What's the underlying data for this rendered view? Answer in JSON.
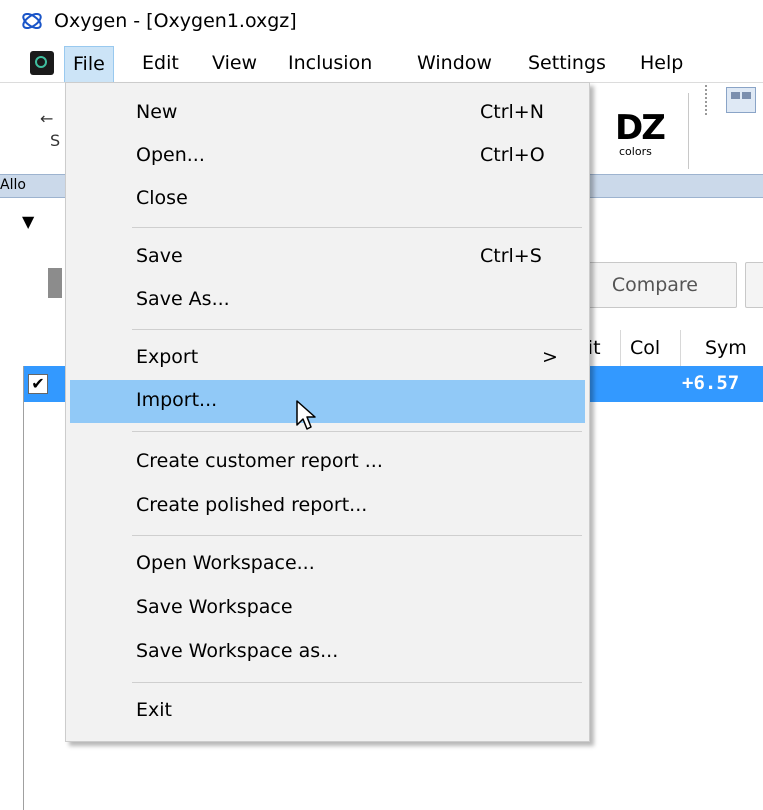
{
  "window": {
    "title": "Oxygen - [Oxygen1.oxgz]",
    "app_icon": "oxygen-logo-icon",
    "accent": "#1a55c8"
  },
  "menubar": {
    "items": [
      {
        "label": "File"
      },
      {
        "label": "Edit"
      },
      {
        "label": "View"
      },
      {
        "label": "Inclusion"
      },
      {
        "label": "Window"
      },
      {
        "label": "Settings"
      },
      {
        "label": "Help"
      }
    ]
  },
  "toolbar": {
    "frag1": "←",
    "frag2": "S",
    "dz_main": "DZ",
    "dz_sub": "colors"
  },
  "panel": {
    "label": "Allo"
  },
  "buttons": {
    "compare": "Compare"
  },
  "table": {
    "headers": [
      "rit",
      "Col",
      "Sym"
    ],
    "row": {
      "checked": "✔",
      "value": "+6.57"
    },
    "selection_color": "#3399ff"
  },
  "file_menu": {
    "highlight_color": "#91c9f7",
    "items": [
      {
        "label": "New",
        "shortcut": "Ctrl+N"
      },
      {
        "label": "Open...",
        "shortcut": "Ctrl+O"
      },
      {
        "label": "Close",
        "shortcut": ""
      },
      {
        "label": "Save",
        "shortcut": "Ctrl+S"
      },
      {
        "label": "Save As...",
        "shortcut": ""
      },
      {
        "label": "Export",
        "shortcut": "",
        "submenu_arrow": ">"
      },
      {
        "label": "Import...",
        "shortcut": "",
        "highlighted": true
      },
      {
        "label": "Create customer report ...",
        "shortcut": ""
      },
      {
        "label": "Create polished report...",
        "shortcut": ""
      },
      {
        "label": "Open Workspace...",
        "shortcut": ""
      },
      {
        "label": "Save Workspace",
        "shortcut": ""
      },
      {
        "label": "Save Workspace as...",
        "shortcut": ""
      },
      {
        "label": "Exit",
        "shortcut": ""
      }
    ]
  }
}
